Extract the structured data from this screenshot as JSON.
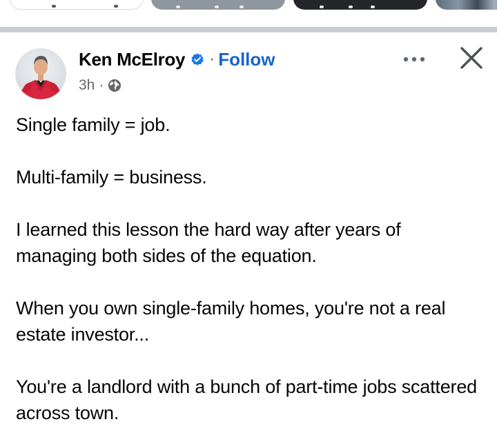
{
  "top_chips": [
    {
      "id": "chip-1",
      "label": ""
    },
    {
      "id": "chip-2",
      "label": ""
    },
    {
      "id": "chip-3",
      "label": ""
    },
    {
      "id": "chip-4",
      "label": ""
    }
  ],
  "post": {
    "author": {
      "name": "Ken McElroy",
      "verified": true,
      "avatar_icon": "person-avatar"
    },
    "follow_separator": "·",
    "follow_label": "Follow",
    "timestamp": "3h",
    "meta_separator": "·",
    "audience_icon": "globe-icon",
    "actions": {
      "more_icon": "more-horizontal-icon",
      "close_icon": "close-icon"
    },
    "paragraphs": [
      "Single family = job.",
      "Multi-family = business.",
      "I learned this lesson the hard way after years of managing both sides of the equation.",
      "When you own single-family homes, you're not a real estate investor...",
      "You're a landlord with a bunch of part-time jobs scattered across town."
    ]
  },
  "colors": {
    "follow": "#1763cf",
    "verified_badge": "#1877f2",
    "secondary_text": "#65676b",
    "separator": "#c9ccd1"
  }
}
